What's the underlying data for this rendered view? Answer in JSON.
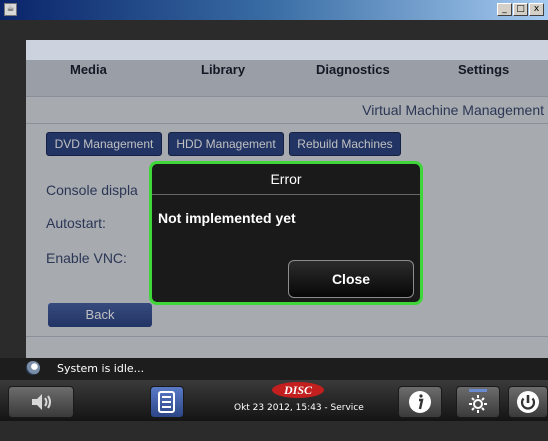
{
  "window": {
    "controls": [
      "_",
      "□",
      "x"
    ]
  },
  "nav": {
    "tabs": [
      {
        "label": "Media"
      },
      {
        "label": "Library"
      },
      {
        "label": "Diagnostics"
      },
      {
        "label": "Settings"
      }
    ]
  },
  "page": {
    "section_title": "Virtual Machine Management",
    "subtabs": [
      {
        "label": "DVD Management"
      },
      {
        "label": "HDD Management"
      },
      {
        "label": "Rebuild Machines"
      }
    ],
    "form": {
      "console_display_label": "Console displa",
      "autostart_label": "Autostart:",
      "enable_vnc_label": "Enable VNC:"
    },
    "back_label": "Back"
  },
  "dialog": {
    "title": "Error",
    "message": "Not implemented yet",
    "close_label": "Close",
    "border_color": "#3fd63a"
  },
  "status": {
    "text": "System is idle..."
  },
  "footer": {
    "logo_text": "DISC",
    "datetime_text": "Okt 23 2012, 15:43 - Service",
    "icons": [
      "volume-icon",
      "document-list-icon",
      "info-icon",
      "brightness-icon",
      "power-icon"
    ]
  }
}
